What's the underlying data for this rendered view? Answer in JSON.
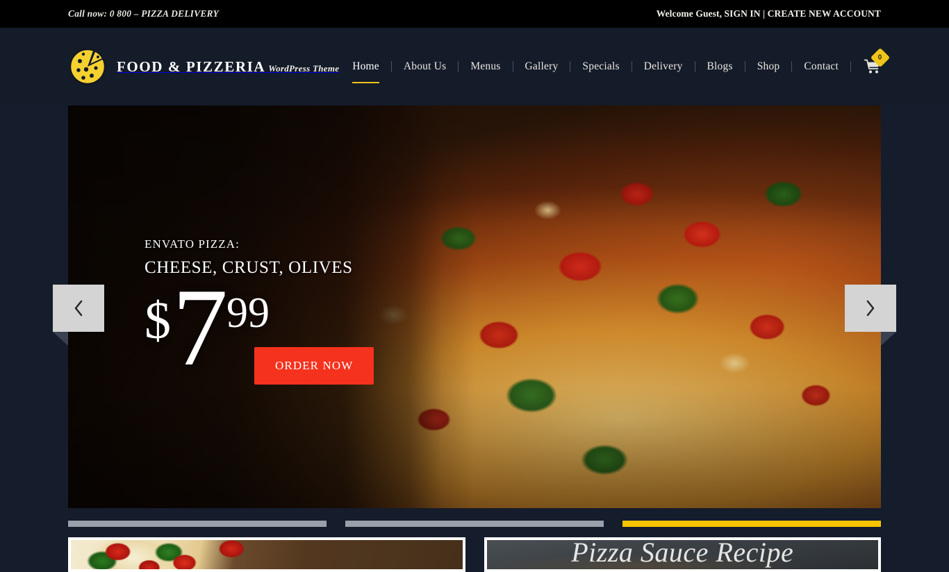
{
  "topbar": {
    "call_now": "Call now: 0 800 – PIZZA DELIVERY",
    "welcome": "Welcome Guest, ",
    "sign_in": "SIGN IN",
    "separator": " | ",
    "create_account": "CREATE NEW ACCOUNT"
  },
  "brand": {
    "title": "FOOD & PIZZERIA",
    "subtitle": "WordPress Theme",
    "logo_icon": "pizza-slice-icon",
    "logo_color": "#f5d130"
  },
  "nav": {
    "items": [
      {
        "label": "Home",
        "active": true
      },
      {
        "label": "About Us",
        "active": false
      },
      {
        "label": "Menus",
        "active": false
      },
      {
        "label": "Gallery",
        "active": false
      },
      {
        "label": "Specials",
        "active": false
      },
      {
        "label": "Delivery",
        "active": false
      },
      {
        "label": "Blogs",
        "active": false
      },
      {
        "label": "Shop",
        "active": false
      },
      {
        "label": "Contact",
        "active": false
      }
    ],
    "active_underline_color": "#f0c419"
  },
  "cart": {
    "icon": "shopping-cart-icon",
    "count": "0",
    "badge_color": "#f0c419"
  },
  "hero": {
    "eyebrow": "ENVATO PIZZA:",
    "title": "CHEESE, CRUST, OLIVES",
    "price_currency": "$",
    "price_integer": "7",
    "price_decimal": "99",
    "cta_label": "ORDER NOW",
    "cta_color": "#f4321d",
    "prev_icon": "chevron-left-icon",
    "next_icon": "chevron-right-icon"
  },
  "slider_bars": [
    {
      "active": false
    },
    {
      "active": false
    },
    {
      "active": true
    }
  ],
  "cards": [
    {
      "name": "pizza-photo-card",
      "caption": ""
    },
    {
      "name": "chalkboard-card",
      "caption": "Pizza Sauce Recipe"
    }
  ],
  "colors": {
    "page_bg": "#151c2b",
    "topbar_bg": "#000000",
    "header_bg": "#141b29",
    "accent_yellow": "#f0c419",
    "accent_red": "#f4321d",
    "bar_inactive": "#9aa0aa",
    "bar_active": "#f6c400"
  }
}
